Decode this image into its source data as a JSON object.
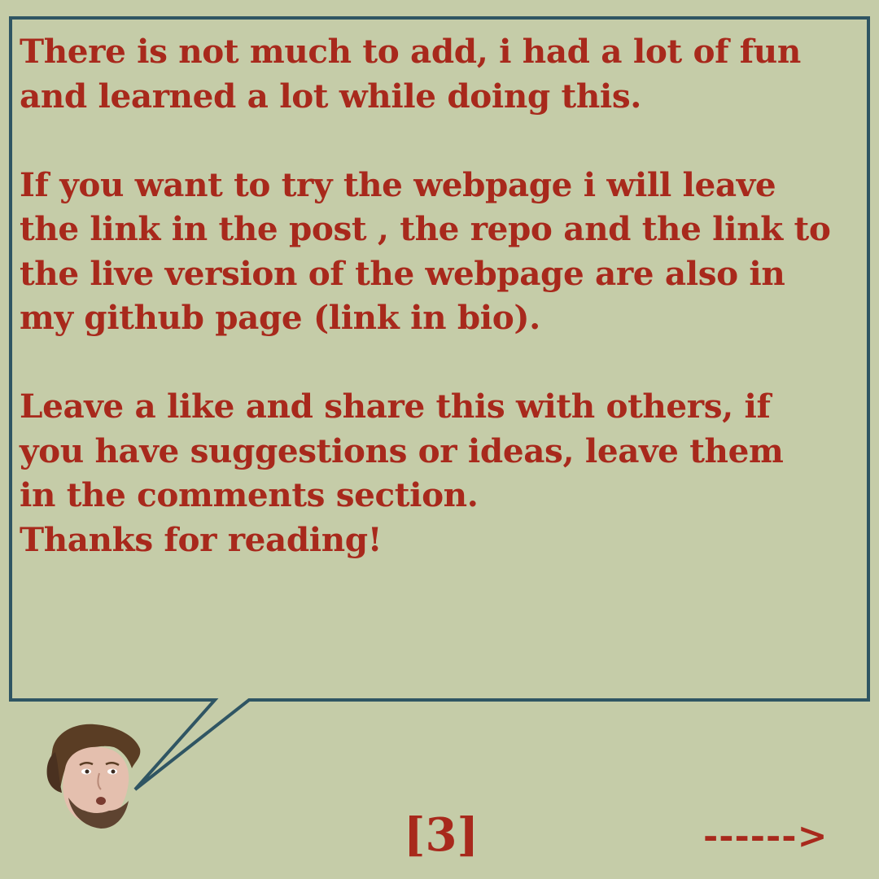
{
  "colors": {
    "background": "#c5cca8",
    "text": "#a8291c",
    "border": "#2f5563"
  },
  "bubble": {
    "paragraphs": [
      [
        "There is not much to add, i had a lot of fun",
        "and learned a lot while doing this."
      ],
      [
        "If you want to try the webpage i will leave",
        "the link in the post , the repo and the link to",
        "the live version of the webpage are also in",
        "my github page (link in bio)."
      ],
      [
        "Leave a like and share this with others, if",
        "you have suggestions or ideas, leave them",
        "in the comments section.",
        "Thanks for reading!"
      ]
    ]
  },
  "footer": {
    "page_number": "[3]",
    "next_arrow": "------>"
  },
  "icons": {
    "avatar": "avatar-photo"
  }
}
